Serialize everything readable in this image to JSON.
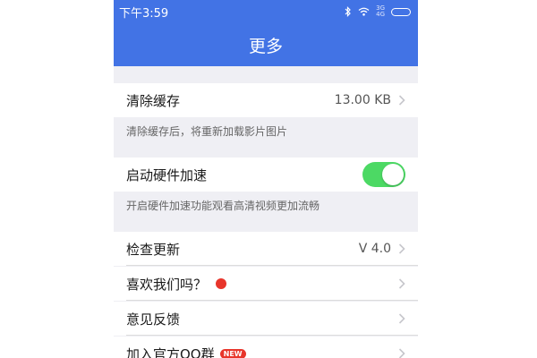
{
  "status_bar": {
    "time": "下午3:59",
    "network_top": "3G",
    "network_bottom": "4G"
  },
  "nav": {
    "title": "更多"
  },
  "settings": {
    "clear_cache": {
      "label": "清除缓存",
      "value": "13.00 KB",
      "note": "清除缓存后，将重新加载影片图片"
    },
    "hw_accel": {
      "label": "启动硬件加速",
      "enabled": true,
      "note": "开启硬件加速功能观看高清视频更加流畅"
    },
    "check_update": {
      "label": "检查更新",
      "value": "V 4.0"
    },
    "like_us": {
      "label": "喜欢我们吗？"
    },
    "feedback": {
      "label": "意见反馈"
    },
    "join_qq": {
      "label": "加入官方QQ群",
      "badge": "NEW"
    }
  },
  "colors": {
    "header_blue": "#4273e5",
    "toggle_green": "#4cd964",
    "badge_red": "#e8352b",
    "page_gray": "#efeff4"
  }
}
